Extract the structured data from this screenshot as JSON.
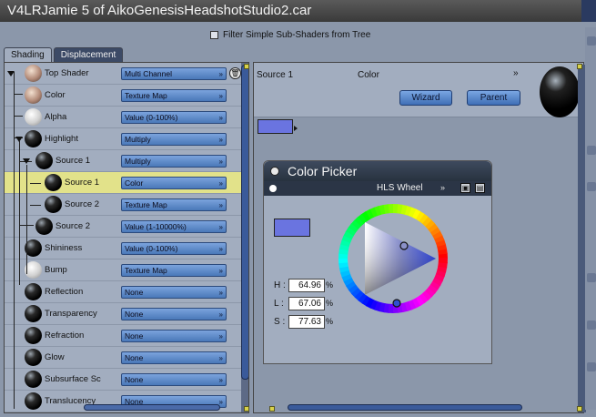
{
  "window": {
    "title": "V4LRJamie 5 of AikoGenesisHeadshotStudio2.car"
  },
  "filter": {
    "label": "Filter Simple Sub-Shaders from Tree",
    "checked": false
  },
  "tabs": [
    {
      "label": "Shading",
      "active": true
    },
    {
      "label": "Displacement",
      "active": false
    }
  ],
  "tree": {
    "rows": [
      {
        "label": "Top Shader",
        "value": "Multi Channel",
        "ball": "skin",
        "selected": false
      },
      {
        "label": "Color",
        "value": "Texture Map",
        "ball": "skin",
        "selected": false
      },
      {
        "label": "Alpha",
        "value": "Value (0-100%)",
        "ball": "white",
        "selected": false
      },
      {
        "label": "Highlight",
        "value": "Multiply",
        "ball": "black",
        "selected": false
      },
      {
        "label": "Source 1",
        "value": "Multiply",
        "ball": "black",
        "selected": false
      },
      {
        "label": "Source 1",
        "value": "Color",
        "ball": "black",
        "selected": true
      },
      {
        "label": "Source 2",
        "value": "Texture Map",
        "ball": "black",
        "selected": false
      },
      {
        "label": "Source 2",
        "value": "Value (1-10000%)",
        "ball": "black",
        "selected": false
      },
      {
        "label": "Shininess",
        "value": "Value (0-100%)",
        "ball": "black",
        "selected": false
      },
      {
        "label": "Bump",
        "value": "Texture Map",
        "ball": "white",
        "selected": false
      },
      {
        "label": "Reflection",
        "value": "None",
        "ball": "black",
        "selected": false
      },
      {
        "label": "Transparency",
        "value": "None",
        "ball": "black",
        "selected": false
      },
      {
        "label": "Refraction",
        "value": "None",
        "ball": "black",
        "selected": false
      },
      {
        "label": "Glow",
        "value": "None",
        "ball": "black",
        "selected": false
      },
      {
        "label": "Subsurface Sc",
        "value": "None",
        "ball": "black",
        "selected": false
      },
      {
        "label": "Translucency",
        "value": "None",
        "ball": "black",
        "selected": false
      }
    ]
  },
  "detail": {
    "source_label": "Source 1",
    "type_label": "Color",
    "chevron": "»",
    "wizard_label": "Wizard",
    "parent_label": "Parent"
  },
  "color_picker": {
    "title": "Color Picker",
    "mode": "HLS Wheel",
    "chevron": "»",
    "color_hex": "#6a74e0",
    "fields": [
      {
        "label": "H :",
        "value": "64.96",
        "unit": "%"
      },
      {
        "label": "L :",
        "value": "67.06",
        "unit": "%"
      },
      {
        "label": "S :",
        "value": "77.63",
        "unit": "%"
      }
    ]
  },
  "icons": {
    "trash": "trash-icon",
    "save": "save-icon",
    "folder": "folder-icon"
  }
}
